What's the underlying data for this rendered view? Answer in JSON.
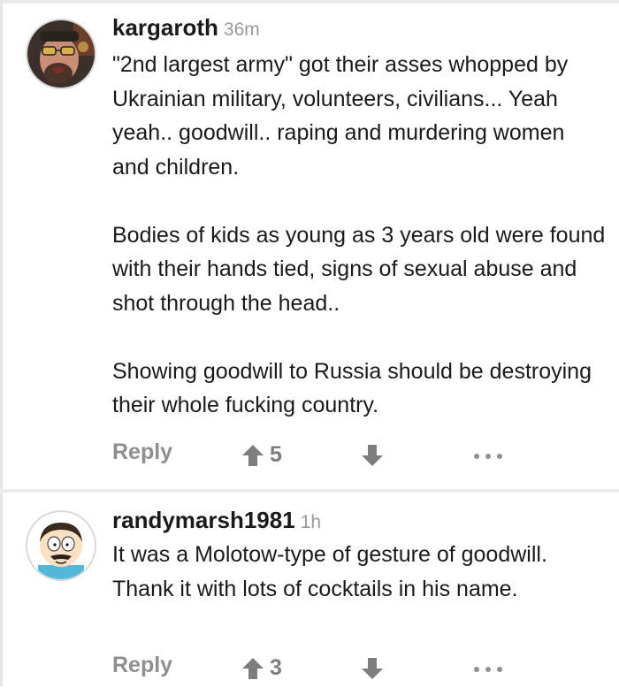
{
  "comments": [
    {
      "username": "kargaroth",
      "timestamp": "36m",
      "paragraphs": [
        "\"2nd largest army\" got their asses whopped by Ukrainian military, volunteers, civilians... Yeah yeah.. goodwill.. raping and murdering women and children.",
        "Bodies of kids as young as 3 years old were found with their hands tied, signs of sexual abuse and shot through the head..",
        "Showing goodwill to Russia should be destroying their whole fucking country."
      ],
      "reply_label": "Reply",
      "upvotes": "5"
    },
    {
      "username": "randymarsh1981",
      "timestamp": "1h",
      "paragraphs": [
        "It was a Molotow-type of gesture of goodwill. Thank it with lots of cocktails in his name."
      ],
      "reply_label": "Reply",
      "upvotes": "3"
    }
  ],
  "colors": {
    "username": "#1a1a1a",
    "timestamp": "#9a9a9a",
    "action_gray": "#8f8f8f",
    "divider": "#ececec"
  },
  "icons": [
    "upvote-arrow-icon",
    "downvote-arrow-icon",
    "more-options-icon"
  ]
}
